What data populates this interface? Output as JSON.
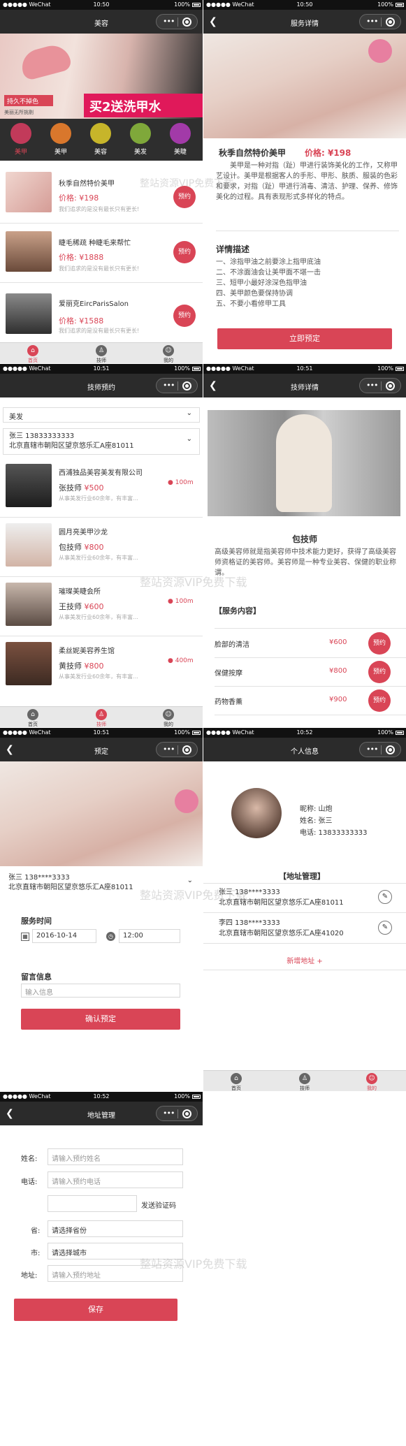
{
  "status": {
    "carrier": "●●●●● WeChat",
    "battery": "100%"
  },
  "s1": {
    "time": "10:50",
    "title": "美容",
    "banner_a": "持久不掉色",
    "banner_b": "买2送洗甲水",
    "banner_c": "美丽无所挑剔",
    "cats": [
      "美甲",
      "美甲",
      "美容",
      "美发",
      "美睫"
    ],
    "items": [
      {
        "name": "秋季自然特价美甲",
        "price": "价格: ¥198",
        "desc": "我们追求的是没有最长只有更长!",
        "btn": "预约"
      },
      {
        "name": "睫毛稀疏 种睫毛来帮忙",
        "price": "价格: ¥1888",
        "desc": "我们追求的是没有最长只有更长!",
        "btn": "预约"
      },
      {
        "name": "爱丽克EircParisSalon",
        "price": "价格: ¥1588",
        "desc": "我们追求的是没有最长只有更长!",
        "btn": "预约"
      }
    ],
    "tabs": [
      "首页",
      "技师",
      "我的"
    ]
  },
  "s2": {
    "time": "10:50",
    "title": "服务详情",
    "name": "秋季自然特价美甲",
    "price": "价格: ¥198",
    "intro": "美甲是一种对指（趾）甲进行装饰美化的工作，又称甲艺设计。美甲是根据客人的手形、甲形、肤质、服装的色彩和要求，对指（趾）甲进行消毒、清洁、护理、保养、修饰美化的过程。具有表现形式多样化的特点。",
    "detail_title": "详情描述",
    "details": [
      "一、涂指甲油之前要涂上指甲底油",
      "二、不涂面油会让美甲面不堪一击",
      "三、短甲小最好涂深色指甲油",
      "四、美甲颜色要保持协调",
      "五、不要小看修甲工具"
    ],
    "button": "立即预定"
  },
  "s3": {
    "time": "10:51",
    "title": "技师预约",
    "filter": "美发",
    "user": "张三 13833333333",
    "address": "北京直辖市朝阳区望京悠乐汇A座81011",
    "techs": [
      {
        "shop": "西浦独品美容美发有限公司",
        "name": "张技师",
        "price": "¥500",
        "desc": "从事美发行业60余年，有丰富...",
        "dist": "100m"
      },
      {
        "shop": "圆月亮美甲沙龙",
        "name": "包技师",
        "price": "¥800",
        "desc": "从事美发行业60余年，有丰富...",
        "dist": ""
      },
      {
        "shop": "璀璨美睫会所",
        "name": "王技师",
        "price": "¥600",
        "desc": "从事美发行业60余年，有丰富...",
        "dist": "100m"
      },
      {
        "shop": "柔丝妮美容养生馆",
        "name": "黄技师",
        "price": "¥800",
        "desc": "从事美发行业60余年，有丰富...",
        "dist": "400m"
      }
    ],
    "tabs": [
      "首页",
      "技师",
      "我的"
    ]
  },
  "s4": {
    "time": "10:51",
    "title": "技师详情",
    "name": "包技师",
    "intro": "高级美容师就是指美容师中技术能力更好，获得了高级美容师资格证的美容师。美容师是一种专业美容、保健的职业称谓。",
    "section": "【服务内容】",
    "services": [
      {
        "name": "脸部的清洁",
        "price": "¥600",
        "btn": "预约"
      },
      {
        "name": "保健按摩",
        "price": "¥800",
        "btn": "预约"
      },
      {
        "name": "药物香薰",
        "price": "¥900",
        "btn": "预约"
      }
    ]
  },
  "s5": {
    "time": "10:51",
    "title": "预定",
    "user": "张三 138****3333",
    "address": "北京直辖市朝阳区望京悠乐汇A座81011",
    "time_label": "服务时间",
    "date": "2016-10-14",
    "hour": "12:00",
    "msg_label": "留言信息",
    "msg_placeholder": "输入信息",
    "button": "确认预定"
  },
  "s6": {
    "time": "10:52",
    "title": "个人信息",
    "nick": "昵称:   山炮",
    "realname": "姓名:   张三",
    "phone": "电话:   13833333333",
    "addr_title": "【地址管理】",
    "addrs": [
      {
        "who": "张三 138****3333",
        "addr": "北京直辖市朝阳区望京悠乐汇A座81011"
      },
      {
        "who": "李四 138****3333",
        "addr": "北京直辖市朝阳区望京悠乐汇A座41020"
      }
    ],
    "add": "新增地址 +",
    "tabs": [
      "首页",
      "技师",
      "我的"
    ]
  },
  "s7": {
    "time": "10:52",
    "title": "地址管理",
    "name_label": "姓名:",
    "name_ph": "请输入预约姓名",
    "phone_label": "电话:",
    "phone_ph": "请输入预约电话",
    "code_btn": "发送验证码",
    "prov_label": "省:",
    "prov": "请选择省份",
    "city_label": "市:",
    "city": "请选择城市",
    "addr_label": "地址:",
    "addr_ph": "请输入预约地址",
    "button": "保存"
  },
  "watermark": "整站资源VIP免费下载",
  "colors": {
    "accent": "#d94556",
    "navbar": "#2b2b2b"
  }
}
